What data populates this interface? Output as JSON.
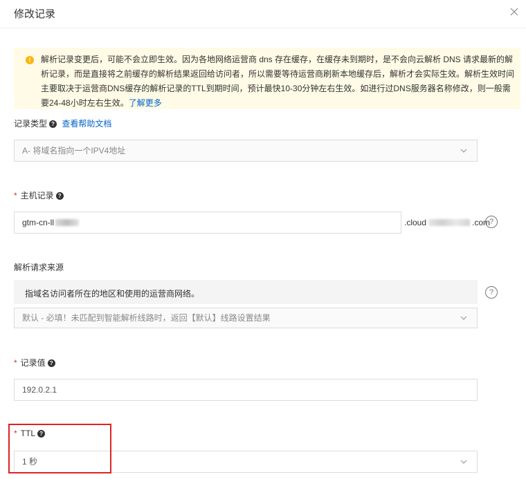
{
  "dialog": {
    "title": "修改记录",
    "close_icon": "close-icon"
  },
  "notice": {
    "icon": "warning-icon",
    "text": "解析记录变更后，可能不会立即生效。因为各地网络运营商 dns 存在缓存，在缓存未到期时，是不会向云解析 DNS 请求最新的解析记录，而是直接将之前缓存的解析结果返回给访问者，所以需要等待运营商刷新本地缓存后，解析才会实际生效。解析生效时间主要取决于运营商DNS缓存的解析记录的TTL到期时间，预计最快10-30分钟左右生效。如进行过DNS服务器名称修改，则一般需要24-48小时左右生效。",
    "link": "了解更多"
  },
  "record_type": {
    "label": "记录类型",
    "help_link": "查看帮助文档",
    "value": "A- 将域名指向一个IPV4地址"
  },
  "host": {
    "label": "主机记录",
    "value": "gtm-cn-ll",
    "suffix_prefix": ".cloud",
    "suffix_end": ".com"
  },
  "source": {
    "label": "解析请求来源",
    "description": "指域名访问者所在的地区和使用的运营商网络。",
    "value": "默认 - 必填！未匹配到智能解析线路时，返回【默认】线路设置结果"
  },
  "record_value": {
    "label": "记录值",
    "value": "192.0.2.1"
  },
  "ttl": {
    "label": "TTL",
    "value": "1 秒"
  },
  "colors": {
    "link": "#0064c8",
    "required": "#d93026",
    "notice_bg": "#fffbe6",
    "warning": "#fab60a",
    "highlight_box": "#e02020"
  }
}
